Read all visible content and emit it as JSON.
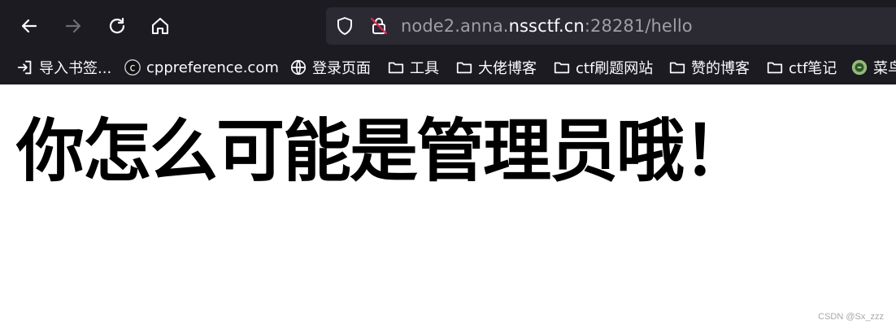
{
  "browser": {
    "url_prefix": "node2.anna.",
    "url_domain": "nssctf.cn",
    "url_suffix": ":28281/hello",
    "bookmarks": [
      {
        "label": "导入书签...",
        "icon": "import-icon"
      },
      {
        "label": "cppreference.com",
        "icon": "cppreference-favicon"
      },
      {
        "label": "登录页面",
        "icon": "globe-icon"
      },
      {
        "label": "工具",
        "icon": "folder-icon"
      },
      {
        "label": "大佬博客",
        "icon": "folder-icon"
      },
      {
        "label": "ctf刷题网站",
        "icon": "folder-icon"
      },
      {
        "label": "赞的博客",
        "icon": "folder-icon"
      },
      {
        "label": "ctf笔记",
        "icon": "folder-icon"
      },
      {
        "label": "菜鸟",
        "icon": "runoob-favicon"
      }
    ]
  },
  "page": {
    "heading": "你怎么可能是管理员哦！"
  },
  "watermark": "CSDN @Sx_zzz"
}
